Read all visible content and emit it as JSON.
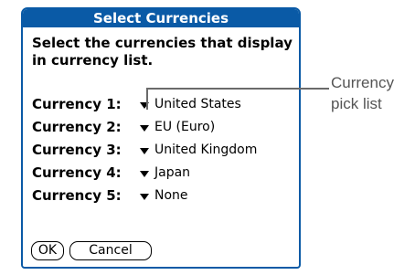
{
  "dialog": {
    "title": "Select Currencies",
    "instruction": "Select the currencies that display in currency list.",
    "currencies": [
      {
        "label": "Currency 1:",
        "value": "United States"
      },
      {
        "label": "Currency 2:",
        "value": "EU (Euro)"
      },
      {
        "label": "Currency 3:",
        "value": "United Kingdom"
      },
      {
        "label": "Currency 4:",
        "value": "Japan"
      },
      {
        "label": "Currency 5:",
        "value": "None"
      }
    ],
    "ok_label": "OK",
    "cancel_label": "Cancel"
  },
  "callout": {
    "line1": "Currency",
    "line2": "pick list"
  },
  "colors": {
    "accent": "#0a5aa6",
    "callout_text": "#555555",
    "callout_line": "#6a6a6a"
  },
  "icons": {
    "picker_arrow": "triangle-down-icon"
  }
}
